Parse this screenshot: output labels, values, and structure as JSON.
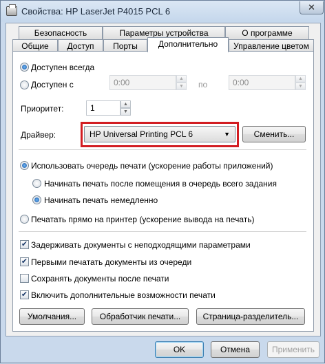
{
  "window": {
    "title": "Свойства: HP LaserJet P4015 PCL 6",
    "close_glyph": "✕"
  },
  "tabs": {
    "row1": [
      "Безопасность",
      "Параметры устройства",
      "О программе"
    ],
    "row2": [
      "Общие",
      "Доступ",
      "Порты",
      "Дополнительно",
      "Управление цветом"
    ],
    "active": "Дополнительно"
  },
  "availability": {
    "always_label": "Доступен всегда",
    "always_selected": true,
    "from_label": "Доступен с",
    "from_value": "0:00",
    "to_label": "по",
    "to_value": "0:00"
  },
  "priority": {
    "label": "Приоритет:",
    "value": "1"
  },
  "driver": {
    "label": "Драйвер:",
    "value": "HP Universal Printing PCL 6",
    "change_button": "Сменить...",
    "highlight_color": "#d21d22"
  },
  "spooling": {
    "use_spool_label": "Использовать очередь печати (ускорение работы приложений)",
    "use_spool_selected": true,
    "after_last_page_label": "Начинать печать после помещения в очередь всего задания",
    "immediately_label": "Начинать печать немедленно",
    "immediately_selected": true,
    "direct_label": "Печатать прямо на принтер (ускорение вывода на печать)"
  },
  "options": [
    {
      "label": "Задерживать документы с неподходящими параметрами",
      "checked": true
    },
    {
      "label": "Первыми печатать документы из очереди",
      "checked": true
    },
    {
      "label": "Сохранять документы после печати",
      "checked": false
    },
    {
      "label": "Включить дополнительные возможности печати",
      "checked": true
    }
  ],
  "buttons": {
    "defaults": "Умолчания...",
    "processor": "Обработчик печати...",
    "separator_page": "Страница-разделитель...",
    "ok": "OK",
    "cancel": "Отмена",
    "apply": "Применить"
  },
  "glyphs": {
    "check": "✔",
    "spin_up": "▲",
    "spin_down": "▼",
    "combo_arrow": "▼"
  }
}
